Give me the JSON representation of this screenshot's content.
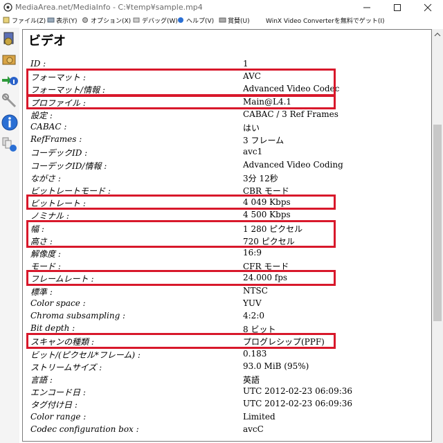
{
  "window": {
    "title": "MediaArea.net/MediaInfo - C:¥temp¥sample.mp4"
  },
  "menu": [
    {
      "label": "ファイル(Z)",
      "icon": "file-icon"
    },
    {
      "label": "表示(Y)",
      "icon": "view-icon"
    },
    {
      "label": "オプション(X)",
      "icon": "options-icon"
    },
    {
      "label": "デバッグ(W)",
      "icon": "debug-icon"
    },
    {
      "label": "ヘルプ(V)",
      "icon": "help-icon"
    },
    {
      "label": "賞賛(U)",
      "icon": "praise-icon"
    },
    {
      "label": "WinX Video Converterを無料でゲット(I)",
      "icon": ""
    }
  ],
  "toolbar": [
    "open-file-icon",
    "open-folder-icon",
    "export-icon",
    "settings-icon",
    "info-icon",
    "knowledge-base-icon"
  ],
  "section": {
    "title": "ビデオ"
  },
  "rows": [
    {
      "label": "ID :",
      "value": "1"
    },
    {
      "label": "フォーマット :",
      "value": "AVC"
    },
    {
      "label": "フォーマット/情報 :",
      "value": "Advanced Video Codec"
    },
    {
      "label": "プロファイル :",
      "value": "Main@L4.1"
    },
    {
      "label": "設定 :",
      "value": "CABAC / 3 Ref Frames"
    },
    {
      "label": "CABAC :",
      "value": "はい"
    },
    {
      "label": "RefFrames :",
      "value": "3 フレーム"
    },
    {
      "label": "コーデックID :",
      "value": "avc1"
    },
    {
      "label": "コーデックID/情報 :",
      "value": "Advanced Video Coding"
    },
    {
      "label": "ながさ :",
      "value": "3分 12秒"
    },
    {
      "label": "ビットレートモード :",
      "value": "CBR モード"
    },
    {
      "label": "ビットレート :",
      "value": "4 049 Kbps"
    },
    {
      "label": "ノミナル :",
      "value": "4 500 Kbps"
    },
    {
      "label": "幅 :",
      "value": "1 280 ピクセル"
    },
    {
      "label": "高さ :",
      "value": "720 ピクセル"
    },
    {
      "label": "解像度 :",
      "value": "16:9"
    },
    {
      "label": "モード :",
      "value": "CFR モード"
    },
    {
      "label": "フレームレート :",
      "value": "24.000 fps"
    },
    {
      "label": "標準 :",
      "value": "NTSC"
    },
    {
      "label": "Color space :",
      "value": "YUV"
    },
    {
      "label": "Chroma subsampling :",
      "value": "4:2:0"
    },
    {
      "label": "Bit depth :",
      "value": "8 ビット"
    },
    {
      "label": "スキャンの種類 :",
      "value": "プログレシップ(PPF)"
    },
    {
      "label": "ビット/(ピクセル*フレーム) :",
      "value": "0.183"
    },
    {
      "label": "ストリームサイズ :",
      "value": "93.0 MiB (95%)"
    },
    {
      "label": "言語 :",
      "value": "英語"
    },
    {
      "label": "エンコード日 :",
      "value": "UTC 2012-02-23 06:09:36"
    },
    {
      "label": "タグ付け日 :",
      "value": "UTC 2012-02-23 06:09:36"
    },
    {
      "label": "Color range :",
      "value": "Limited"
    },
    {
      "label": "Codec configuration box :",
      "value": "avcC"
    }
  ],
  "highlight_color": "#d8182b"
}
